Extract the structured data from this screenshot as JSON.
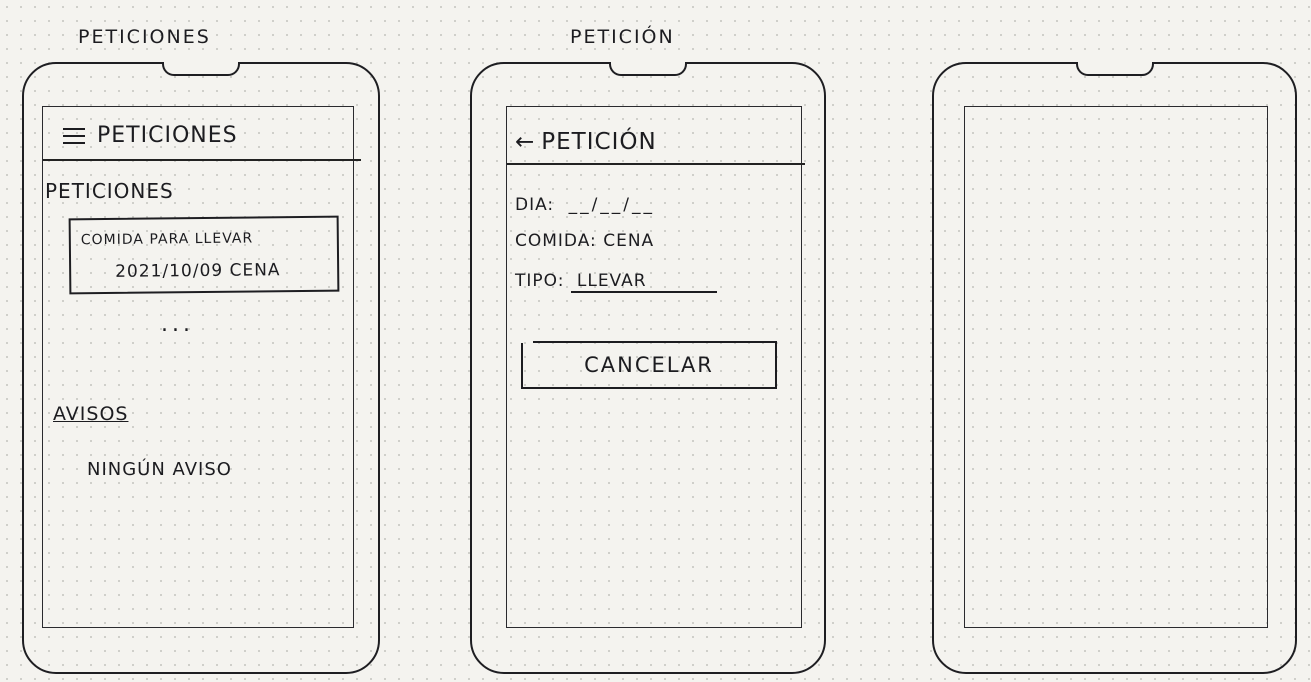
{
  "labels": {
    "screen1": "PETICIONES",
    "screen2": "PETICIÓN"
  },
  "screen1": {
    "appbar_title": "PETICIONES",
    "section_title": "PETICIONES",
    "card_line1": "COMIDA PARA LLEVAR",
    "card_line2": "2021/10/09 CENA",
    "more": "...",
    "notices_title": "AVISOS",
    "notices_empty": "NINGÚN AVISO"
  },
  "screen2": {
    "appbar_title": "PETICIÓN",
    "back_icon": "←",
    "dia_label": "DIA:",
    "dia_value": "__/__/__",
    "comida_label": "COMIDA:",
    "comida_value": "CENA",
    "tipo_label": "TIPO:",
    "tipo_value": "LLEVAR",
    "cancel_label": "CANCELAR"
  },
  "colors": {
    "ink": "#1c1c20",
    "paper": "#f4f3ef"
  }
}
